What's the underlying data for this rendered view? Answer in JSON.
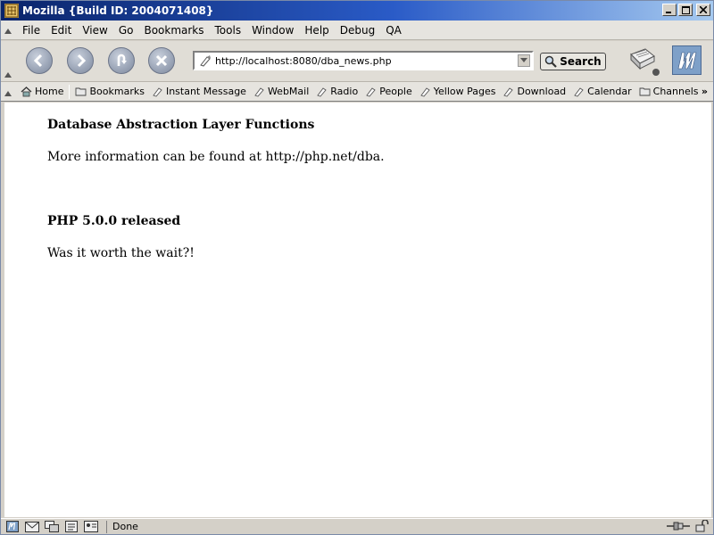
{
  "window": {
    "title": "Mozilla {Build ID: 2004071408}",
    "minimize": "_",
    "maximize": "□",
    "close": "×"
  },
  "menu": {
    "items": [
      {
        "label": "File"
      },
      {
        "label": "Edit"
      },
      {
        "label": "View"
      },
      {
        "label": "Go"
      },
      {
        "label": "Bookmarks"
      },
      {
        "label": "Tools"
      },
      {
        "label": "Window"
      },
      {
        "label": "Help"
      },
      {
        "label": "Debug"
      },
      {
        "label": "QA"
      }
    ]
  },
  "navigation": {
    "url": "http://localhost:8080/dba_news.php",
    "search_label": "Search"
  },
  "personal_toolbar": {
    "home": "Home",
    "bookmarks": "Bookmarks",
    "items": [
      {
        "label": "Instant Message"
      },
      {
        "label": "WebMail"
      },
      {
        "label": "Radio"
      },
      {
        "label": "People"
      },
      {
        "label": "Yellow Pages"
      },
      {
        "label": "Download"
      },
      {
        "label": "Calendar"
      }
    ],
    "channels": "Channels",
    "more": "»"
  },
  "content": {
    "articles": [
      {
        "title": "Database Abstraction Layer Functions",
        "body": "More information can be found at http://php.net/dba."
      },
      {
        "title": "PHP 5.0.0 released",
        "body": "Was it worth the wait?!"
      }
    ]
  },
  "status": {
    "text": "Done"
  },
  "colors": {
    "titlebar_start": "#0a246a",
    "titlebar_end": "#a6caf0",
    "chrome": "#d4d0c8",
    "content_bg": "#ffffff"
  }
}
